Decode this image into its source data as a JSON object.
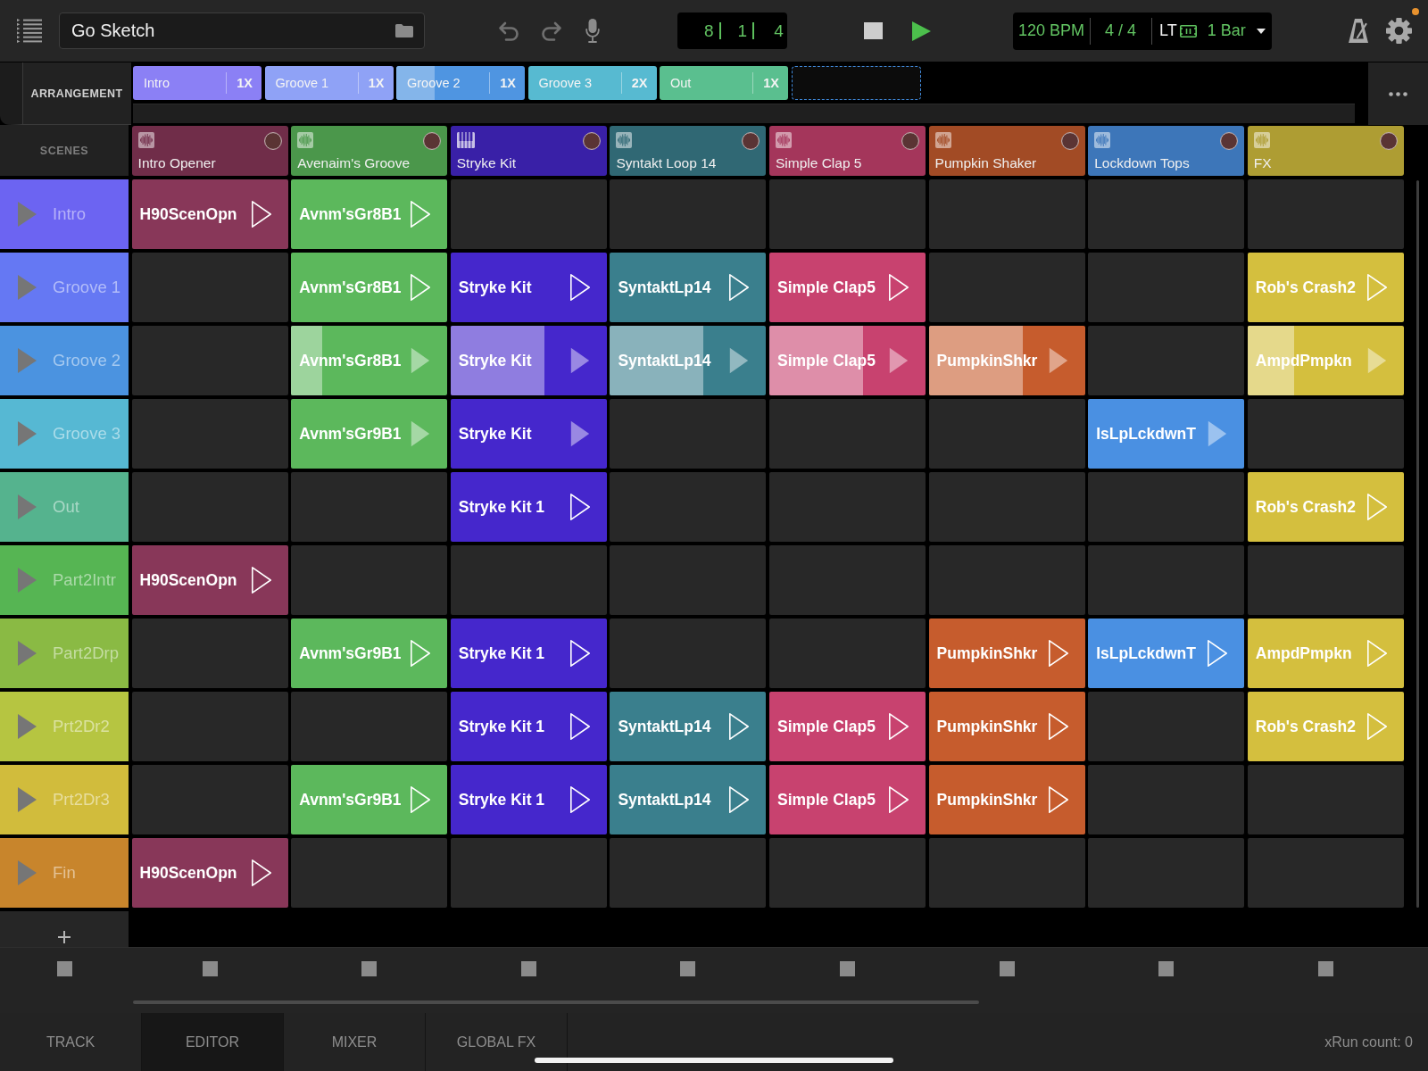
{
  "toolbar": {
    "project_name": "Go Sketch",
    "counter": [
      "8",
      "1",
      "4"
    ],
    "tempo": "120 BPM",
    "time_signature": "4 / 4",
    "quantize_label": "LT",
    "quantize": "1 Bar",
    "settings_badge": true
  },
  "arrangement": {
    "label": "ARRANGEMENT",
    "parts": [
      {
        "name": "Intro",
        "repeat": "1X",
        "color": "#8b80f5"
      },
      {
        "name": "Groove 1",
        "repeat": "1X",
        "color": "#8fa2f6"
      },
      {
        "name": "Groove 2",
        "repeat": "1X",
        "color": "#4f95e1",
        "level": 0.3
      },
      {
        "name": "Groove 3",
        "repeat": "2X",
        "color": "#57bad1"
      },
      {
        "name": "Out",
        "repeat": "1X",
        "color": "#5abf8f"
      }
    ],
    "add_slot": true
  },
  "scenes_label": "SCENES",
  "tracks": [
    {
      "name": "Intro Opener",
      "kind": "audio",
      "color": "#883759"
    },
    {
      "name": "Avenaim's Groove",
      "kind": "audio",
      "color": "#5cb85c"
    },
    {
      "name": "Stryke Kit",
      "kind": "instrument",
      "color": "#4527cc"
    },
    {
      "name": "Syntakt Loop 14",
      "kind": "audio",
      "color": "#3a7f8d"
    },
    {
      "name": "Simple Clap 5",
      "kind": "audio",
      "color": "#c8426f"
    },
    {
      "name": "Pumpkin Shaker",
      "kind": "audio",
      "color": "#c65c2d"
    },
    {
      "name": "Lockdown Tops",
      "kind": "audio",
      "color": "#4a90e2"
    },
    {
      "name": "FX",
      "kind": "audio",
      "color": "#d4bf3e"
    }
  ],
  "scenes": [
    {
      "name": "Intro",
      "color": "#6c64f2",
      "clips": [
        {
          "kind": "clip",
          "name": "H90ScenOpn",
          "launched": false
        },
        {
          "kind": "clip",
          "name": "Avnm'sGr8B1",
          "launched": false
        },
        {
          "kind": "empty"
        },
        {
          "kind": "empty"
        },
        {
          "kind": "empty"
        },
        {
          "kind": "empty"
        },
        {
          "kind": "empty"
        },
        {
          "kind": "empty"
        }
      ]
    },
    {
      "name": "Groove 1",
      "color": "#6578f3",
      "clips": [
        {
          "kind": "empty"
        },
        {
          "kind": "clip",
          "name": "Avnm'sGr8B1",
          "launched": false
        },
        {
          "kind": "clip",
          "name": "Stryke Kit",
          "launched": false
        },
        {
          "kind": "clip",
          "name": "SyntaktLp14",
          "launched": false
        },
        {
          "kind": "clip",
          "name": "Simple Clap5",
          "launched": false
        },
        {
          "kind": "empty"
        },
        {
          "kind": "empty"
        },
        {
          "kind": "clip",
          "name": "Rob's Crash2",
          "launched": false
        }
      ]
    },
    {
      "name": "Groove 2",
      "color": "#4b93e0",
      "clips": [
        {
          "kind": "empty"
        },
        {
          "kind": "clip",
          "name": "Avnm'sGr8B1",
          "launched": true,
          "level": 0.2
        },
        {
          "kind": "clip",
          "name": "Stryke Kit",
          "launched": true,
          "level": 0.6
        },
        {
          "kind": "clip",
          "name": "SyntaktLp14",
          "launched": true,
          "level": 0.6
        },
        {
          "kind": "clip",
          "name": "Simple Clap5",
          "launched": true,
          "level": 0.6
        },
        {
          "kind": "clip",
          "name": "PumpkinShkr",
          "launched": true,
          "level": 0.6
        },
        {
          "kind": "empty"
        },
        {
          "kind": "clip",
          "name": "AmpdPmpkn",
          "launched": true,
          "level": 0.3
        }
      ]
    },
    {
      "name": "Groove 3",
      "color": "#56b8d3",
      "clips": [
        {
          "kind": "empty"
        },
        {
          "kind": "clip",
          "name": "Avnm'sGr9B1",
          "launched": true
        },
        {
          "kind": "clip",
          "name": "Stryke Kit",
          "launched": true
        },
        {
          "kind": "empty"
        },
        {
          "kind": "empty"
        },
        {
          "kind": "empty"
        },
        {
          "kind": "clip",
          "name": "IsLpLckdwnT",
          "launched": true
        },
        {
          "kind": "empty"
        }
      ]
    },
    {
      "name": "Out",
      "color": "#55b38e",
      "clips": [
        {
          "kind": "empty"
        },
        {
          "kind": "empty"
        },
        {
          "kind": "clip",
          "name": "Stryke Kit 1",
          "launched": false
        },
        {
          "kind": "empty"
        },
        {
          "kind": "empty"
        },
        {
          "kind": "empty"
        },
        {
          "kind": "empty"
        },
        {
          "kind": "clip",
          "name": "Rob's Crash2",
          "launched": false
        }
      ]
    },
    {
      "name": "Part2Intr",
      "color": "#56b553",
      "clips": [
        {
          "kind": "clip",
          "name": "H90ScenOpn",
          "launched": false
        },
        {
          "kind": "empty"
        },
        {
          "kind": "empty"
        },
        {
          "kind": "empty"
        },
        {
          "kind": "empty"
        },
        {
          "kind": "empty"
        },
        {
          "kind": "empty"
        },
        {
          "kind": "empty"
        }
      ]
    },
    {
      "name": "Part2Drp",
      "color": "#8aba44",
      "clips": [
        {
          "kind": "empty"
        },
        {
          "kind": "clip",
          "name": "Avnm'sGr9B1",
          "launched": false
        },
        {
          "kind": "clip",
          "name": "Stryke Kit 1",
          "launched": false
        },
        {
          "kind": "empty"
        },
        {
          "kind": "empty"
        },
        {
          "kind": "clip",
          "name": "PumpkinShkr",
          "launched": false
        },
        {
          "kind": "clip",
          "name": "IsLpLckdwnT",
          "launched": false
        },
        {
          "kind": "clip",
          "name": "AmpdPmpkn",
          "launched": false
        }
      ]
    },
    {
      "name": "Prt2Dr2",
      "color": "#b6c541",
      "clips": [
        {
          "kind": "empty"
        },
        {
          "kind": "empty"
        },
        {
          "kind": "clip",
          "name": "Stryke Kit 1",
          "launched": false
        },
        {
          "kind": "clip",
          "name": "SyntaktLp14",
          "launched": false
        },
        {
          "kind": "clip",
          "name": "Simple Clap5",
          "launched": false
        },
        {
          "kind": "clip",
          "name": "PumpkinShkr",
          "launched": false
        },
        {
          "kind": "empty"
        },
        {
          "kind": "clip",
          "name": "Rob's Crash2",
          "launched": false
        }
      ]
    },
    {
      "name": "Prt2Dr3",
      "color": "#d1bc3c",
      "clips": [
        {
          "kind": "empty"
        },
        {
          "kind": "clip",
          "name": "Avnm'sGr9B1",
          "launched": false
        },
        {
          "kind": "clip",
          "name": "Stryke Kit 1",
          "launched": false
        },
        {
          "kind": "clip",
          "name": "SyntaktLp14",
          "launched": false
        },
        {
          "kind": "clip",
          "name": "Simple Clap5",
          "launched": false
        },
        {
          "kind": "clip",
          "name": "PumpkinShkr",
          "launched": false
        },
        {
          "kind": "empty"
        },
        {
          "kind": "empty"
        }
      ]
    },
    {
      "name": "Fin",
      "color": "#c8852c",
      "clips": [
        {
          "kind": "clip",
          "name": "H90ScenOpn",
          "launched": false
        },
        {
          "kind": "empty"
        },
        {
          "kind": "empty"
        },
        {
          "kind": "empty"
        },
        {
          "kind": "empty"
        },
        {
          "kind": "empty"
        },
        {
          "kind": "empty"
        },
        {
          "kind": "empty"
        }
      ]
    }
  ],
  "tabs": [
    {
      "label": "TRACK",
      "selected": false
    },
    {
      "label": "EDITOR",
      "selected": true
    },
    {
      "label": "MIXER",
      "selected": false
    },
    {
      "label": "GLOBAL FX",
      "selected": false
    }
  ],
  "status": "xRun count: 0"
}
